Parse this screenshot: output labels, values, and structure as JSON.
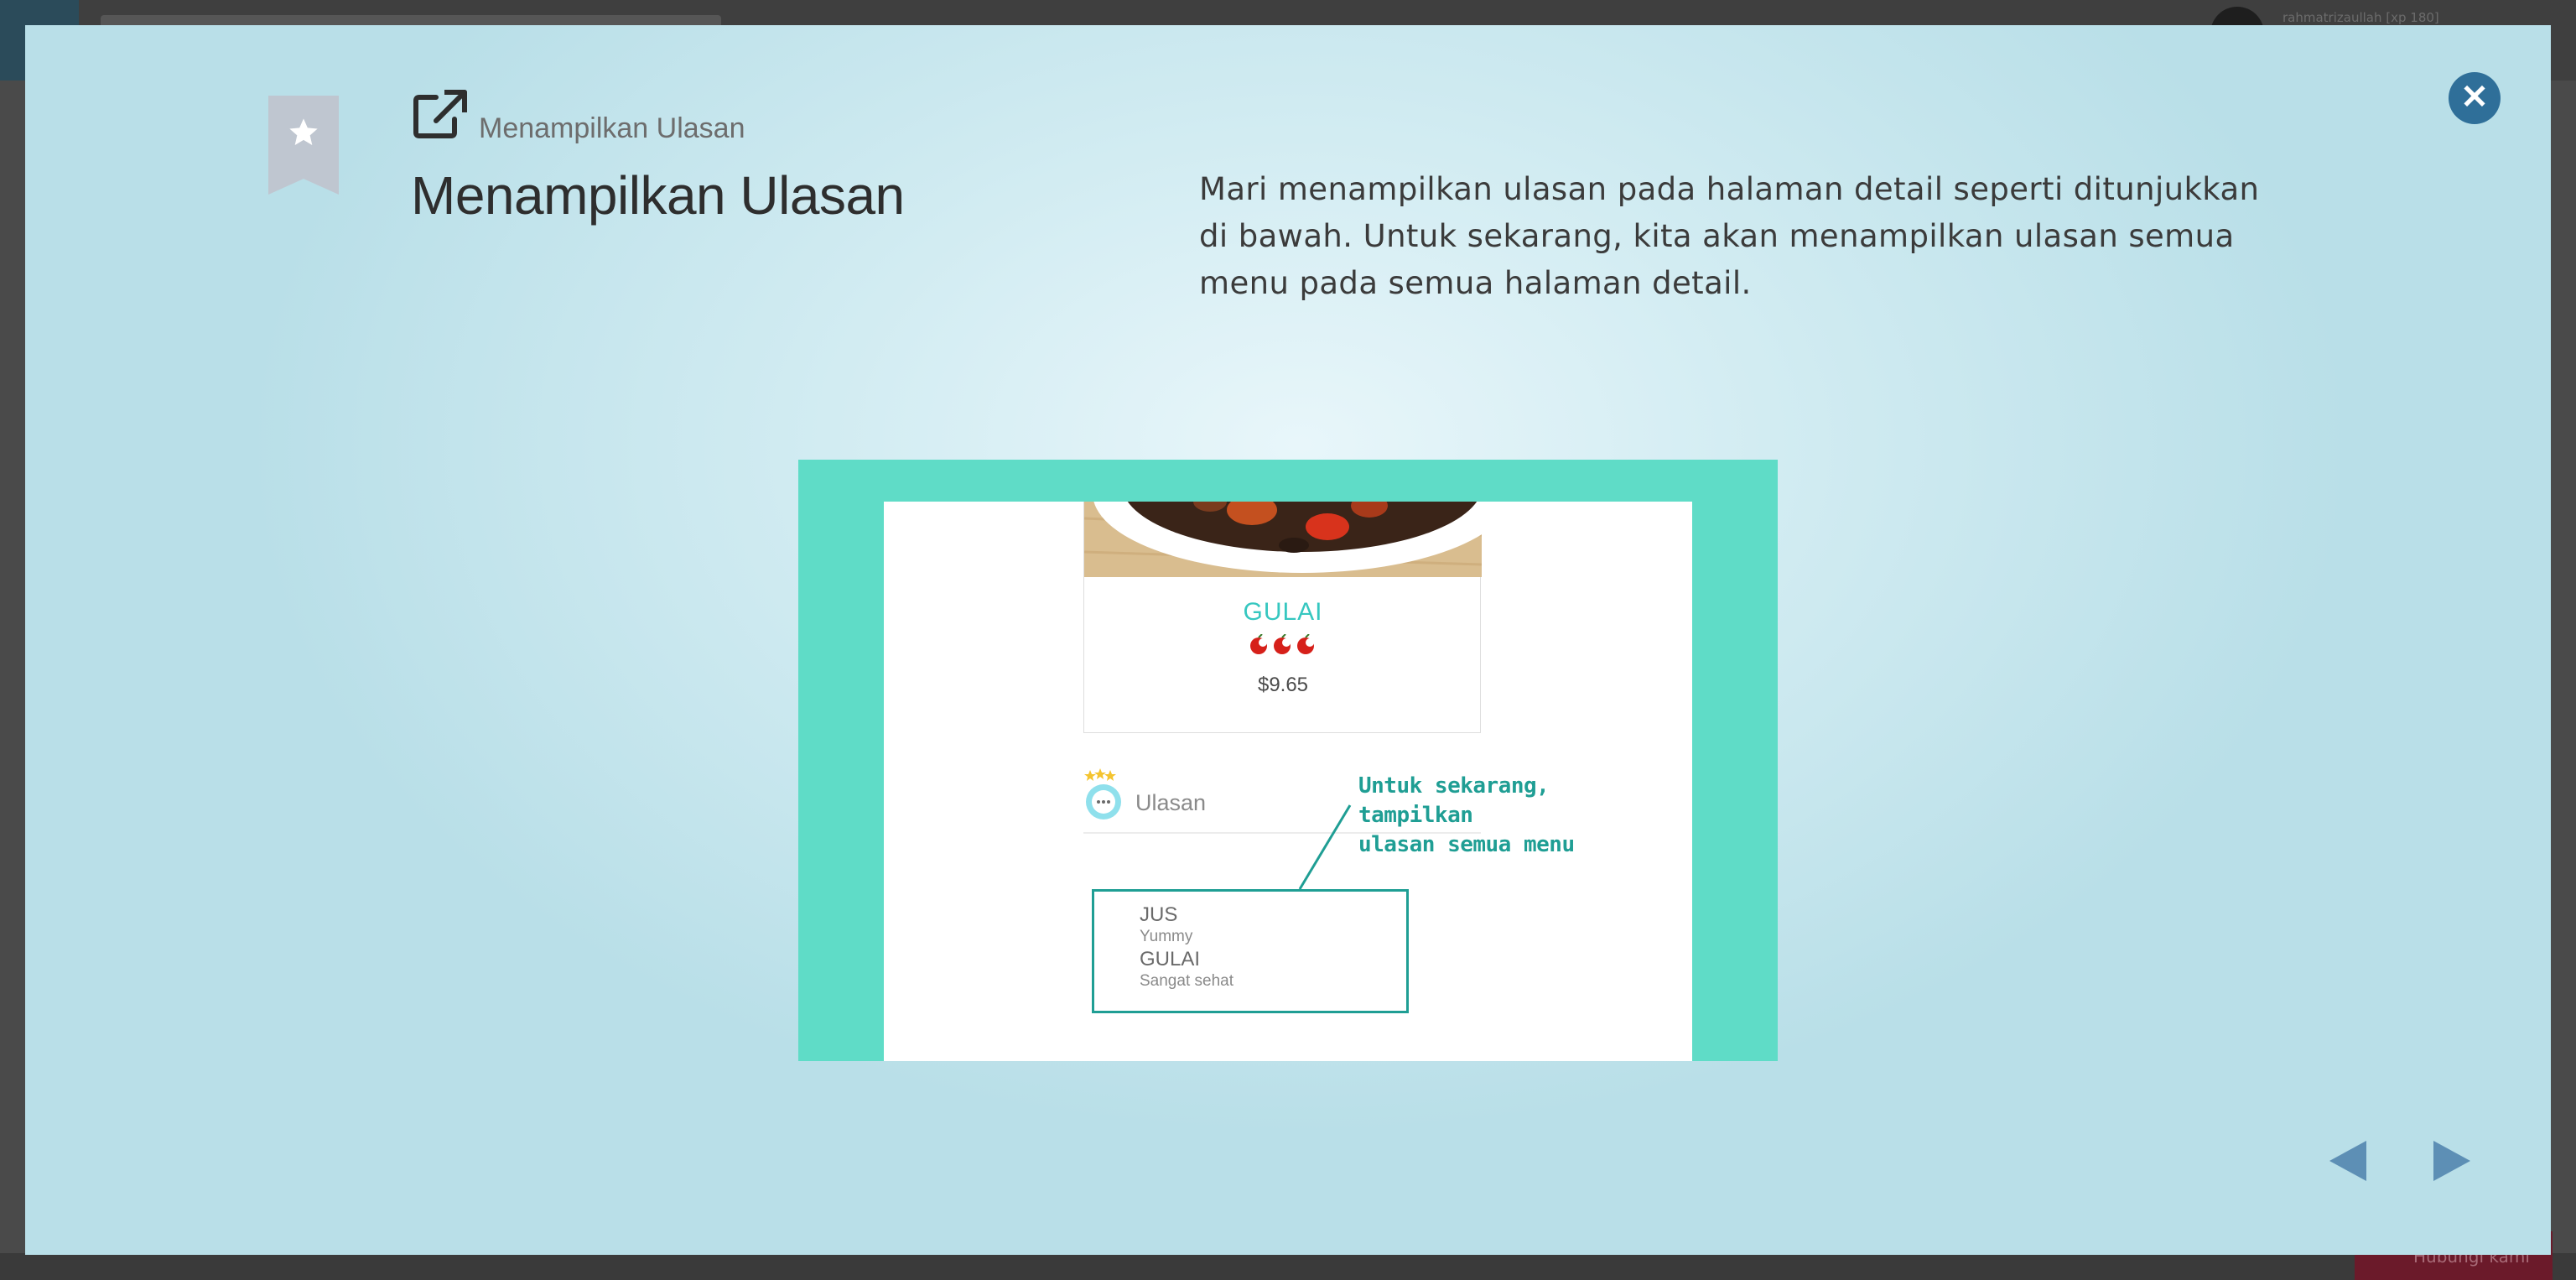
{
  "background_page": {
    "username": "rahmatrizaullah [xp 180]",
    "bottom_button_label": "Hubungi kami"
  },
  "modal": {
    "breadcrumb": "Menampilkan Ulasan",
    "title": "Menampilkan Ulasan",
    "description": "Mari menampilkan ulasan pada halaman detail seperti ditunjukkan di bawah. Untuk sekarang, kita akan menampilkan ulasan semua menu pada semua halaman detail.",
    "icons": {
      "bookmark": "star-bookmark-icon",
      "external_link": "external-link-icon",
      "close": "close-icon",
      "prev": "triangle-left-icon",
      "next": "triangle-right-icon"
    },
    "colors": {
      "accent_teal": "#5fdcc7",
      "annotation": "#1f9e94",
      "close_button": "#2f6f99",
      "nav_arrow": "#5d8fb5"
    }
  },
  "illustration": {
    "food_name": "GULAI",
    "price": "$9.65",
    "spice_level": 3,
    "reviews_label": "Ulasan",
    "annotation": [
      "Untuk sekarang, tampilkan",
      "ulasan semua menu"
    ],
    "reviews": [
      {
        "name": "JUS",
        "text": "Yummy"
      },
      {
        "name": "GULAI",
        "text": "Sangat sehat"
      }
    ]
  }
}
